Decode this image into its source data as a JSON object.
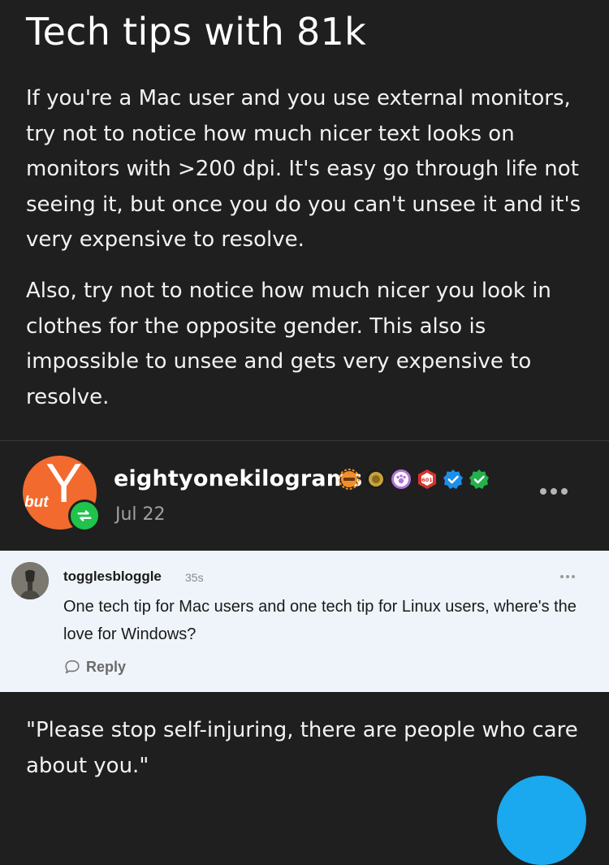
{
  "post": {
    "title": "Tech tips with 81k",
    "paragraphs": [
      "If you're a Mac user and you use external monitors, try not to notice how much nicer text looks on monitors with >200 dpi. It's easy go through life not seeing it, but once you do you can't unsee it and it's very expensive to resolve.",
      "Also, try not to notice how much nicer you look in clothes for the opposite gender. This also is impossible to unsee and gets very expensive to resolve."
    ]
  },
  "reblog": {
    "avatar_letter": "Y",
    "avatar_text": "but",
    "username": "eightyonekilograms",
    "date": "Jul 22",
    "badge_icons": [
      "orange-gear-badge-icon",
      "gold-coin-badge-icon",
      "purple-paw-badge-icon",
      "red-hexagon-badge-icon",
      "blue-checkmark-badge-icon",
      "green-checkmark-badge-icon"
    ],
    "badge_colors": [
      "#f0902a",
      "#c9a23a",
      "#b074d8",
      "#d9332b",
      "#1d8fe8",
      "#22b14c"
    ],
    "badge_text": "601"
  },
  "comment": {
    "username": "togglesbloggle",
    "time": "35s",
    "text": "One tech tip for Mac users and one tech tip for Linux users, where's the love for Windows?",
    "reply_label": "Reply"
  },
  "next_post": {
    "text": "\"Please stop self-injuring, there are people who care about you.\""
  },
  "colors": {
    "background": "#1f1f1f",
    "comment_background": "#eef4fa",
    "avatar_orange": "#f26a2e",
    "reblog_green": "#20c34b",
    "fab_blue": "#1aa8ee"
  }
}
